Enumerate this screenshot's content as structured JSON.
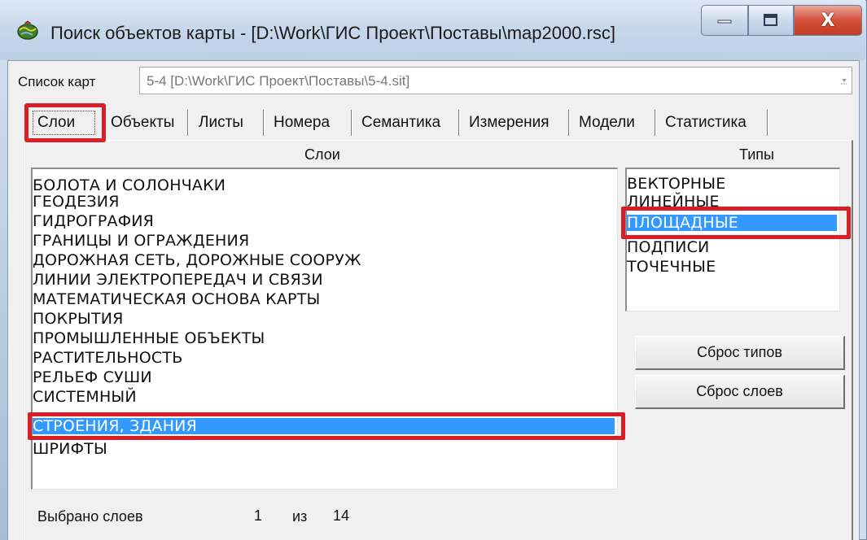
{
  "window": {
    "title": "Поиск объектов карты - [D:\\Work\\ГИС Проект\\Поставы\\map2000.rsc]",
    "close_glyph": "X"
  },
  "map_list": {
    "label": "Список карт",
    "value": "5-4 [D:\\Work\\ГИС Проект\\Поставы\\5-4.sit]"
  },
  "tabs": [
    {
      "label": "Слои",
      "active": true
    },
    {
      "label": "Объекты"
    },
    {
      "label": "Листы"
    },
    {
      "label": "Номера"
    },
    {
      "label": "Семантика"
    },
    {
      "label": "Измерения"
    },
    {
      "label": "Модели"
    },
    {
      "label": "Статистика"
    }
  ],
  "layers": {
    "header": "Слои",
    "items": [
      "БОЛОТА И СОЛОНЧАКИ",
      "ГЕОДЕЗИЯ",
      "ГИДРОГРАФИЯ",
      "ГРАНИЦЫ И ОГРАЖДЕНИЯ",
      "ДОРОЖНАЯ СЕТЬ, ДОРОЖНЫЕ СООРУЖ",
      "ЛИНИИ ЭЛЕКТРОПЕРЕДАЧ И СВЯЗИ",
      "МАТЕМАТИЧЕСКАЯ ОСНОВА КАРТЫ",
      "ПОКРЫТИЯ",
      "ПРОМЫШЛЕННЫЕ ОБЪЕКТЫ",
      "РАСТИТЕЛЬНОСТЬ",
      "РЕЛЬЕФ  СУШИ",
      "СИСТЕМНЫЙ",
      "СТРОЕНИЯ, ЗДАНИЯ",
      "ШРИФТЫ"
    ],
    "selected": "СТРОЕНИЯ, ЗДАНИЯ"
  },
  "types": {
    "header": "Типы",
    "items": [
      "ВЕКТОРНЫЕ",
      "ЛИНЕЙНЫЕ",
      "ПЛОЩАДНЫЕ",
      "ПОДПИСИ",
      "ТОЧЕЧНЫЕ"
    ],
    "selected": "ПЛОЩАДНЫЕ"
  },
  "buttons": {
    "reset_types": "Сброс типов",
    "reset_layers": "Сброс слоев"
  },
  "footer": {
    "label": "Выбрано слоев",
    "selected_count": "1",
    "of_label": "из",
    "total_count": "14"
  },
  "colors": {
    "selection": "#3399ff",
    "highlight": "#d81f26",
    "close_button": "#c23a22"
  }
}
